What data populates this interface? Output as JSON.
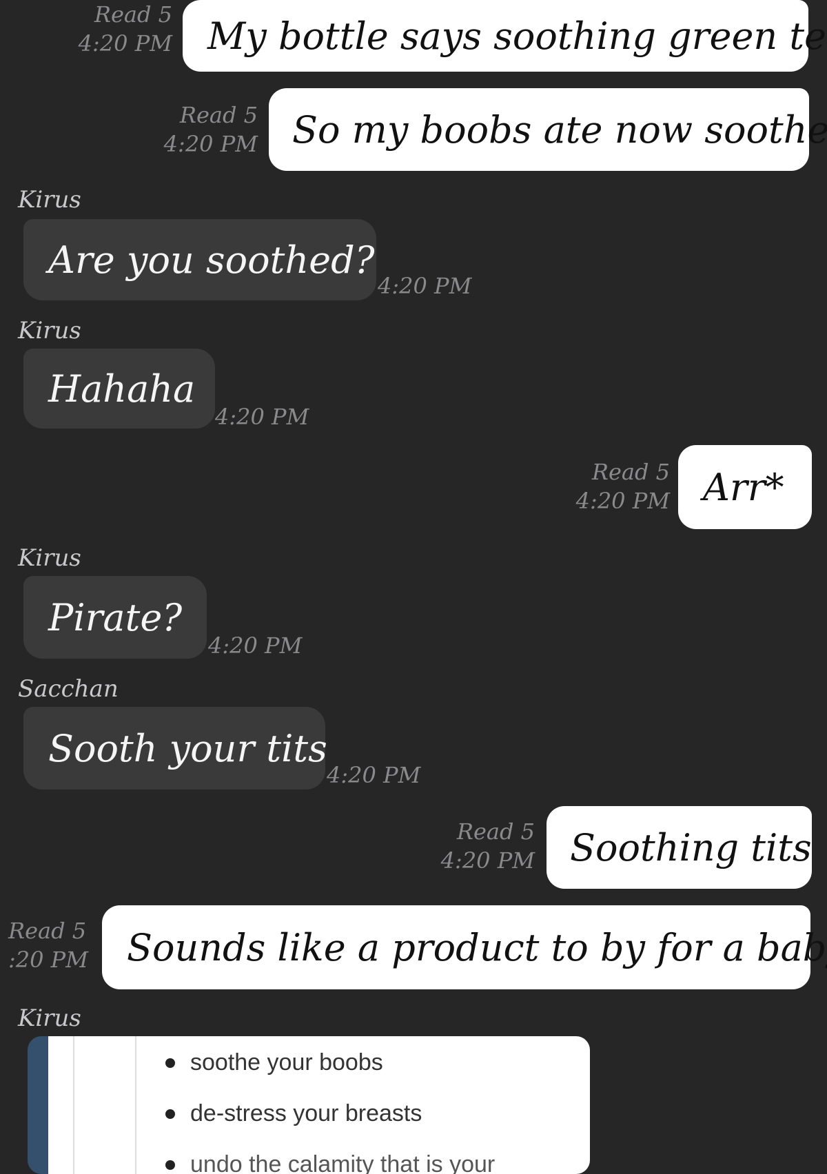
{
  "messages": [
    {
      "id": "m1",
      "from": "me",
      "text": "My bottle says soothing green tea",
      "read": "Read 5",
      "time": "4:20 PM"
    },
    {
      "id": "m2",
      "from": "me",
      "text": "So my boobs ate now soothed",
      "read": "Read 5",
      "time": "4:20 PM"
    },
    {
      "id": "m3",
      "from": "Kirus",
      "text": "Are you soothed?",
      "time": "4:20 PM"
    },
    {
      "id": "m4",
      "from": "Kirus",
      "text": "Hahaha",
      "time": "4:20 PM"
    },
    {
      "id": "m5",
      "from": "me",
      "text": "Arr*",
      "read": "Read 5",
      "time": "4:20 PM"
    },
    {
      "id": "m6",
      "from": "Kirus",
      "text": "Pirate?",
      "time": "4:20 PM"
    },
    {
      "id": "m7",
      "from": "Sacchan",
      "text": "Sooth your tits",
      "time": "4:20 PM"
    },
    {
      "id": "m8",
      "from": "me",
      "text": "Soothing tits",
      "read": "Read 5",
      "time": "4:20 PM"
    },
    {
      "id": "m9",
      "from": "me",
      "text": "Sounds like a product to by for a baby",
      "read": "Read 5",
      "time": ":20 PM"
    }
  ],
  "image_message": {
    "from": "Kirus",
    "bullets": [
      "soothe your boobs",
      "de-stress your breasts",
      "undo the calamity that is your"
    ]
  },
  "colors": {
    "background": "#262627",
    "incoming_bubble": "#3a3a3b",
    "outgoing_bubble": "#ffffff",
    "meta_text": "#8a8a8c"
  }
}
